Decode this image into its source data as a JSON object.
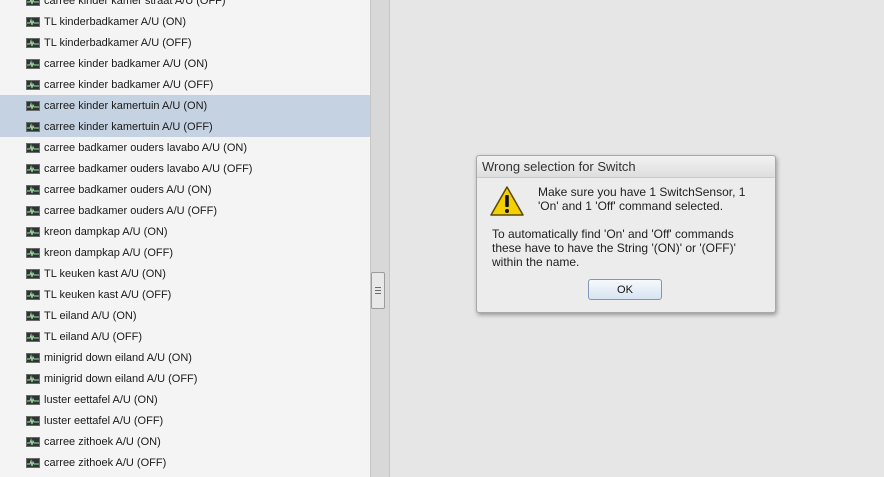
{
  "device_list": {
    "items": [
      {
        "label": "carree kinder kamer straat A/U (OFF)",
        "selected": false
      },
      {
        "label": "TL kinderbadkamer A/U (ON)",
        "selected": false
      },
      {
        "label": "TL kinderbadkamer A/U (OFF)",
        "selected": false
      },
      {
        "label": "carree kinder badkamer A/U (ON)",
        "selected": false
      },
      {
        "label": "carree kinder badkamer A/U (OFF)",
        "selected": false
      },
      {
        "label": "carree kinder kamertuin A/U (ON)",
        "selected": true
      },
      {
        "label": "carree kinder kamertuin A/U (OFF)",
        "selected": true
      },
      {
        "label": "carree badkamer ouders lavabo A/U (ON)",
        "selected": false
      },
      {
        "label": "carree badkamer ouders lavabo A/U (OFF)",
        "selected": false
      },
      {
        "label": "carree badkamer ouders A/U (ON)",
        "selected": false
      },
      {
        "label": "carree badkamer ouders A/U (OFF)",
        "selected": false
      },
      {
        "label": "kreon dampkap A/U (ON)",
        "selected": false
      },
      {
        "label": "kreon dampkap A/U (OFF)",
        "selected": false
      },
      {
        "label": "TL keuken kast A/U (ON)",
        "selected": false
      },
      {
        "label": "TL keuken kast A/U (OFF)",
        "selected": false
      },
      {
        "label": "TL eiland A/U (ON)",
        "selected": false
      },
      {
        "label": "TL eiland A/U (OFF)",
        "selected": false
      },
      {
        "label": "minigrid down eiland A/U (ON)",
        "selected": false
      },
      {
        "label": "minigrid down eiland A/U (OFF)",
        "selected": false
      },
      {
        "label": "luster eettafel A/U (ON)",
        "selected": false
      },
      {
        "label": "luster eettafel A/U (OFF)",
        "selected": false
      },
      {
        "label": "carree zithoek A/U (ON)",
        "selected": false
      },
      {
        "label": "carree zithoek A/U (OFF)",
        "selected": false
      }
    ],
    "item_icon": "command-icon"
  },
  "dialog": {
    "title": "Wrong selection for Switch",
    "icon": "warning-icon",
    "message_1": "Make sure you have 1 SwitchSensor, 1\n'On' and 1 'Off' command selected.",
    "message_2": "To automatically find 'On' and 'Off' commands\nthese have to have the String '(ON)' or '(OFF)'\nwithin the name.",
    "ok_label": "OK"
  },
  "colors": {
    "selection": "#c5d2e2",
    "warning": "#f5d000"
  }
}
